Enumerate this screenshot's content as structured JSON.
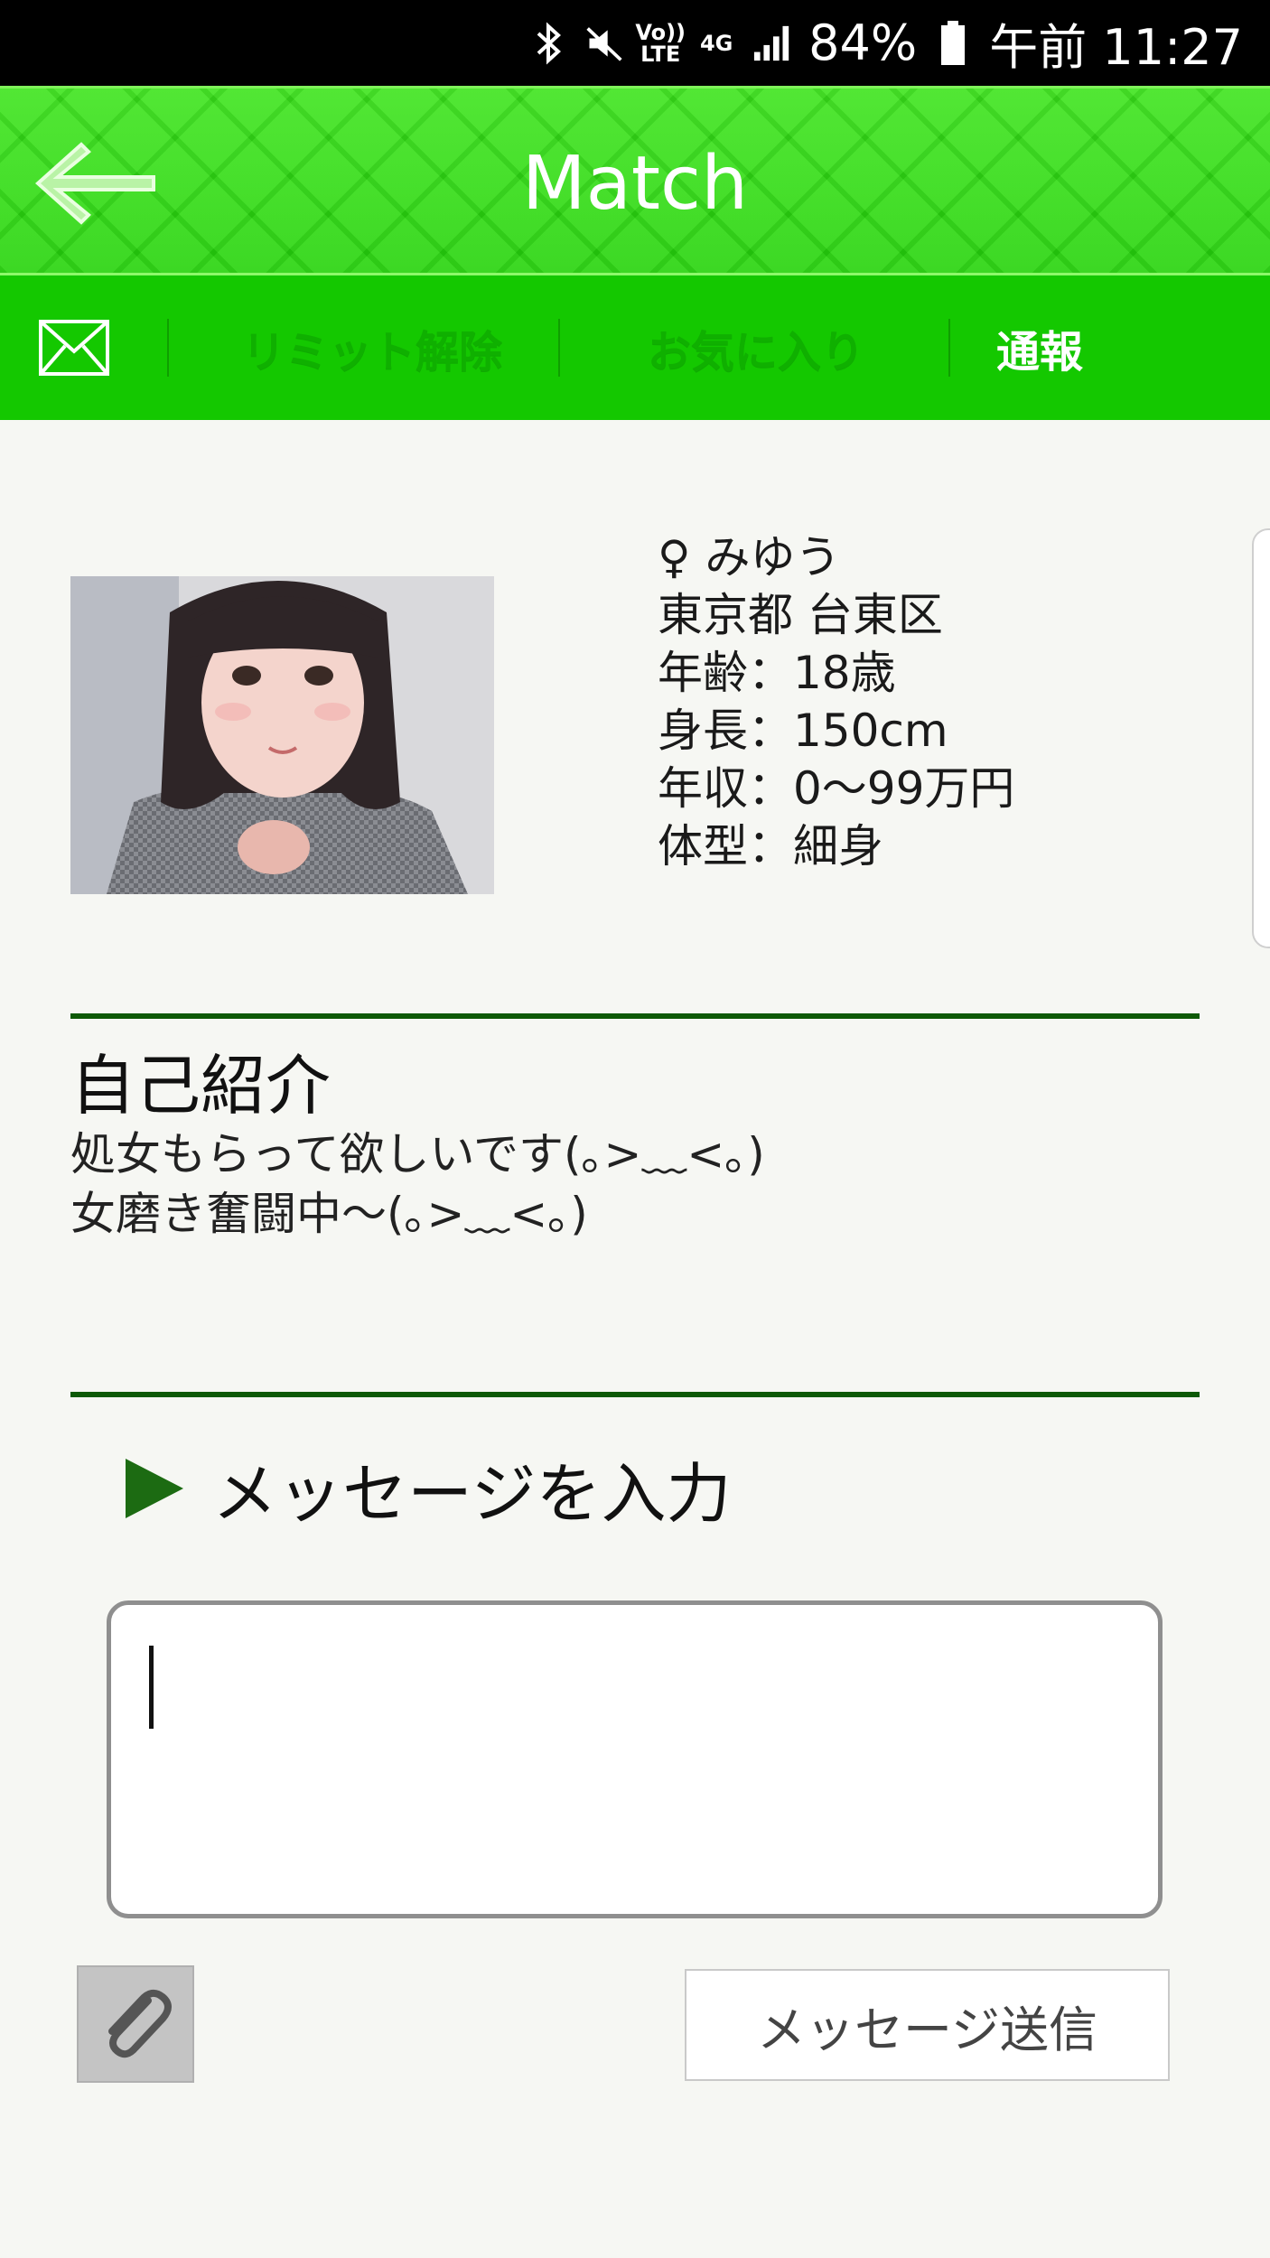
{
  "status_bar": {
    "icons": [
      "bluetooth-icon",
      "mute-icon",
      "volte-icon",
      "4g-icon",
      "signal-icon",
      "battery-icon"
    ],
    "volte_label": "Vo)) LTE",
    "network_label": "4G",
    "battery_percent": "84%",
    "time": "午前 11:27"
  },
  "header": {
    "back_icon": "back-arrow-icon",
    "title": "Match"
  },
  "tabs": {
    "mail_icon": "mail-icon",
    "items": [
      {
        "label": "リミット解除",
        "state": "disabled"
      },
      {
        "label": "お気に入り",
        "state": "disabled"
      },
      {
        "label": "通報",
        "state": "active"
      }
    ]
  },
  "profile": {
    "name_line": "♀ みゆう",
    "location": "東京都 台東区",
    "age": "年齢：18歳",
    "height": "身長：150cm",
    "income": "年収：0〜99万円",
    "body_type": "体型：細身"
  },
  "intro": {
    "title": "自己紹介",
    "lines": [
      "処女もらって欲しいです(｡>﹏<｡)",
      "女磨き奮闘中〜(｡>﹏<｡)"
    ]
  },
  "message": {
    "heading": "メッセージを入力",
    "input_value": "",
    "attach_icon": "paperclip-icon",
    "send_label": "メッセージ送信"
  },
  "colors": {
    "header_green": "#27d40c",
    "tab_green": "#14c800",
    "rule_green": "#0e5a07"
  }
}
